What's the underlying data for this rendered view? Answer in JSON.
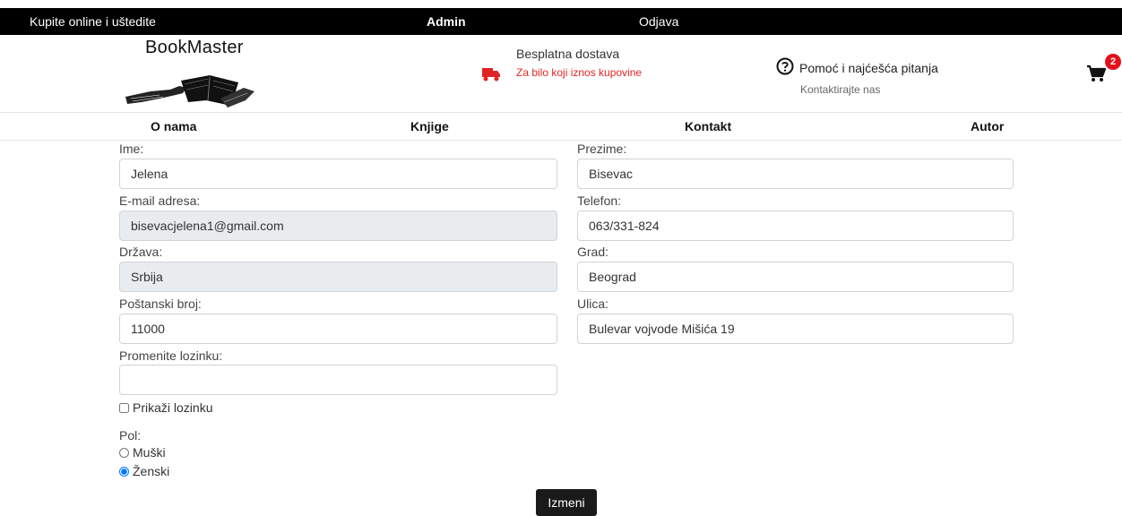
{
  "topbar": {
    "promo": "Kupite online i uštedite",
    "admin": "Admin",
    "logout": "Odjava"
  },
  "header": {
    "logo_text": "BookMaster",
    "shipping_title": "Besplatna dostava",
    "shipping_subtitle": "Za bilo koji iznos kupovine",
    "help_title": "Pomoć i najćešća pitanja",
    "help_subtitle": "Kontaktirajte nas",
    "cart_count": "2",
    "truck_icon": "truck-icon",
    "help_icon": "question-circle-icon",
    "cart_icon": "shopping-cart-icon",
    "accent_red": "#e02424"
  },
  "nav": {
    "about": "O nama",
    "books": "Knjige",
    "contact": "Kontakt",
    "author": "Autor"
  },
  "form": {
    "first_name": {
      "label": "Ime:",
      "value": "Jelena"
    },
    "last_name": {
      "label": "Prezime:",
      "value": "Bisevac"
    },
    "email": {
      "label": "E-mail adresa:",
      "value": "bisevacjelena1@gmail.com"
    },
    "phone": {
      "label": "Telefon:",
      "value": "063/331-824"
    },
    "country": {
      "label": "Država:",
      "value": "Srbija"
    },
    "city": {
      "label": "Grad:",
      "value": "Beograd"
    },
    "postal_code": {
      "label": "Poštanski broj:",
      "value": "11000"
    },
    "street": {
      "label": "Ulica:",
      "value": "Bulevar vojvode Mišića 19"
    },
    "password": {
      "label": "Promenite lozinku:",
      "value": ""
    },
    "show_password": {
      "label": "Prikaži lozinku",
      "checked": false
    },
    "gender": {
      "label": "Pol:",
      "options": [
        {
          "label": "Muški",
          "selected": false
        },
        {
          "label": "Ženski",
          "selected": true
        }
      ]
    },
    "submit_label": "Izmeni"
  }
}
